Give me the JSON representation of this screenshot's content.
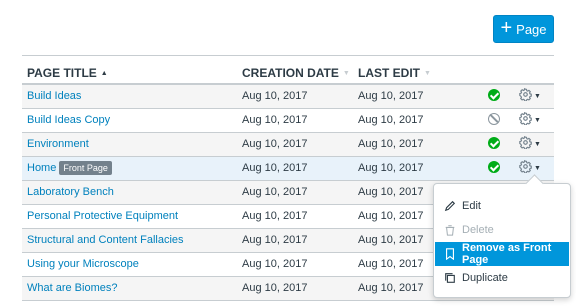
{
  "toolbar": {
    "add_page_icon": "plus-icon",
    "add_page_label": "Page",
    "accent_color": "#0096db"
  },
  "table": {
    "columns": [
      {
        "label": "PAGE TITLE",
        "sort": "ascending"
      },
      {
        "label": "CREATION DATE",
        "sort": "none"
      },
      {
        "label": "LAST EDIT",
        "sort": "none"
      }
    ],
    "rows": [
      {
        "title": "Build Ideas",
        "created": "Aug 10, 2017",
        "edited": "Aug 10, 2017",
        "status": "published",
        "badge": ""
      },
      {
        "title": "Build Ideas Copy",
        "created": "Aug 10, 2017",
        "edited": "Aug 10, 2017",
        "status": "unpublished",
        "badge": ""
      },
      {
        "title": "Environment",
        "created": "Aug 10, 2017",
        "edited": "Aug 10, 2017",
        "status": "published",
        "badge": ""
      },
      {
        "title": "Home",
        "created": "Aug 10, 2017",
        "edited": "Aug 10, 2017",
        "status": "published",
        "badge": "Front Page"
      },
      {
        "title": "Laboratory Bench",
        "created": "Aug 10, 2017",
        "edited": "Aug 10, 2017",
        "status": "",
        "badge": ""
      },
      {
        "title": "Personal Protective Equipment",
        "created": "Aug 10, 2017",
        "edited": "Aug 10, 2017",
        "status": "",
        "badge": ""
      },
      {
        "title": "Structural and Content Fallacies",
        "created": "Aug 10, 2017",
        "edited": "Aug 10, 2017",
        "status": "",
        "badge": ""
      },
      {
        "title": "Using your Microscope",
        "created": "Aug 10, 2017",
        "edited": "Aug 10, 2017",
        "status": "",
        "badge": ""
      },
      {
        "title": "What are Biomes?",
        "created": "Aug 10, 2017",
        "edited": "Aug 10, 2017",
        "status": "",
        "badge": ""
      }
    ]
  },
  "menu": {
    "items": [
      {
        "label": "Edit",
        "icon": "pencil-icon",
        "state": "normal"
      },
      {
        "label": "Delete",
        "icon": "trash-icon",
        "state": "disabled"
      },
      {
        "label": "Remove as Front Page",
        "icon": "bookmark-icon",
        "state": "active"
      },
      {
        "label": "Duplicate",
        "icon": "duplicate-icon",
        "state": "normal"
      }
    ]
  }
}
